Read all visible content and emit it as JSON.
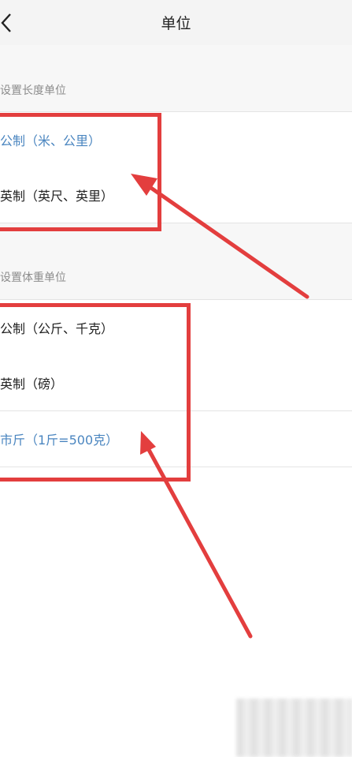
{
  "header": {
    "title": "单位",
    "back_icon": "chevron-left-icon"
  },
  "length_section": {
    "label": "设置长度单位",
    "options": [
      "公制（米、公里）",
      "英制（英尺、英里）"
    ],
    "selected_index": 0
  },
  "weight_section": {
    "label": "设置体重单位",
    "options": [
      "公制（公斤、千克）",
      "英制（磅）",
      "市斤（1斤=500克）"
    ],
    "selected_index": 2
  },
  "colors": {
    "selected_text": "#4b86c0",
    "annotation_red": "#e33e3e",
    "section_bg": "#f7f7f7"
  }
}
